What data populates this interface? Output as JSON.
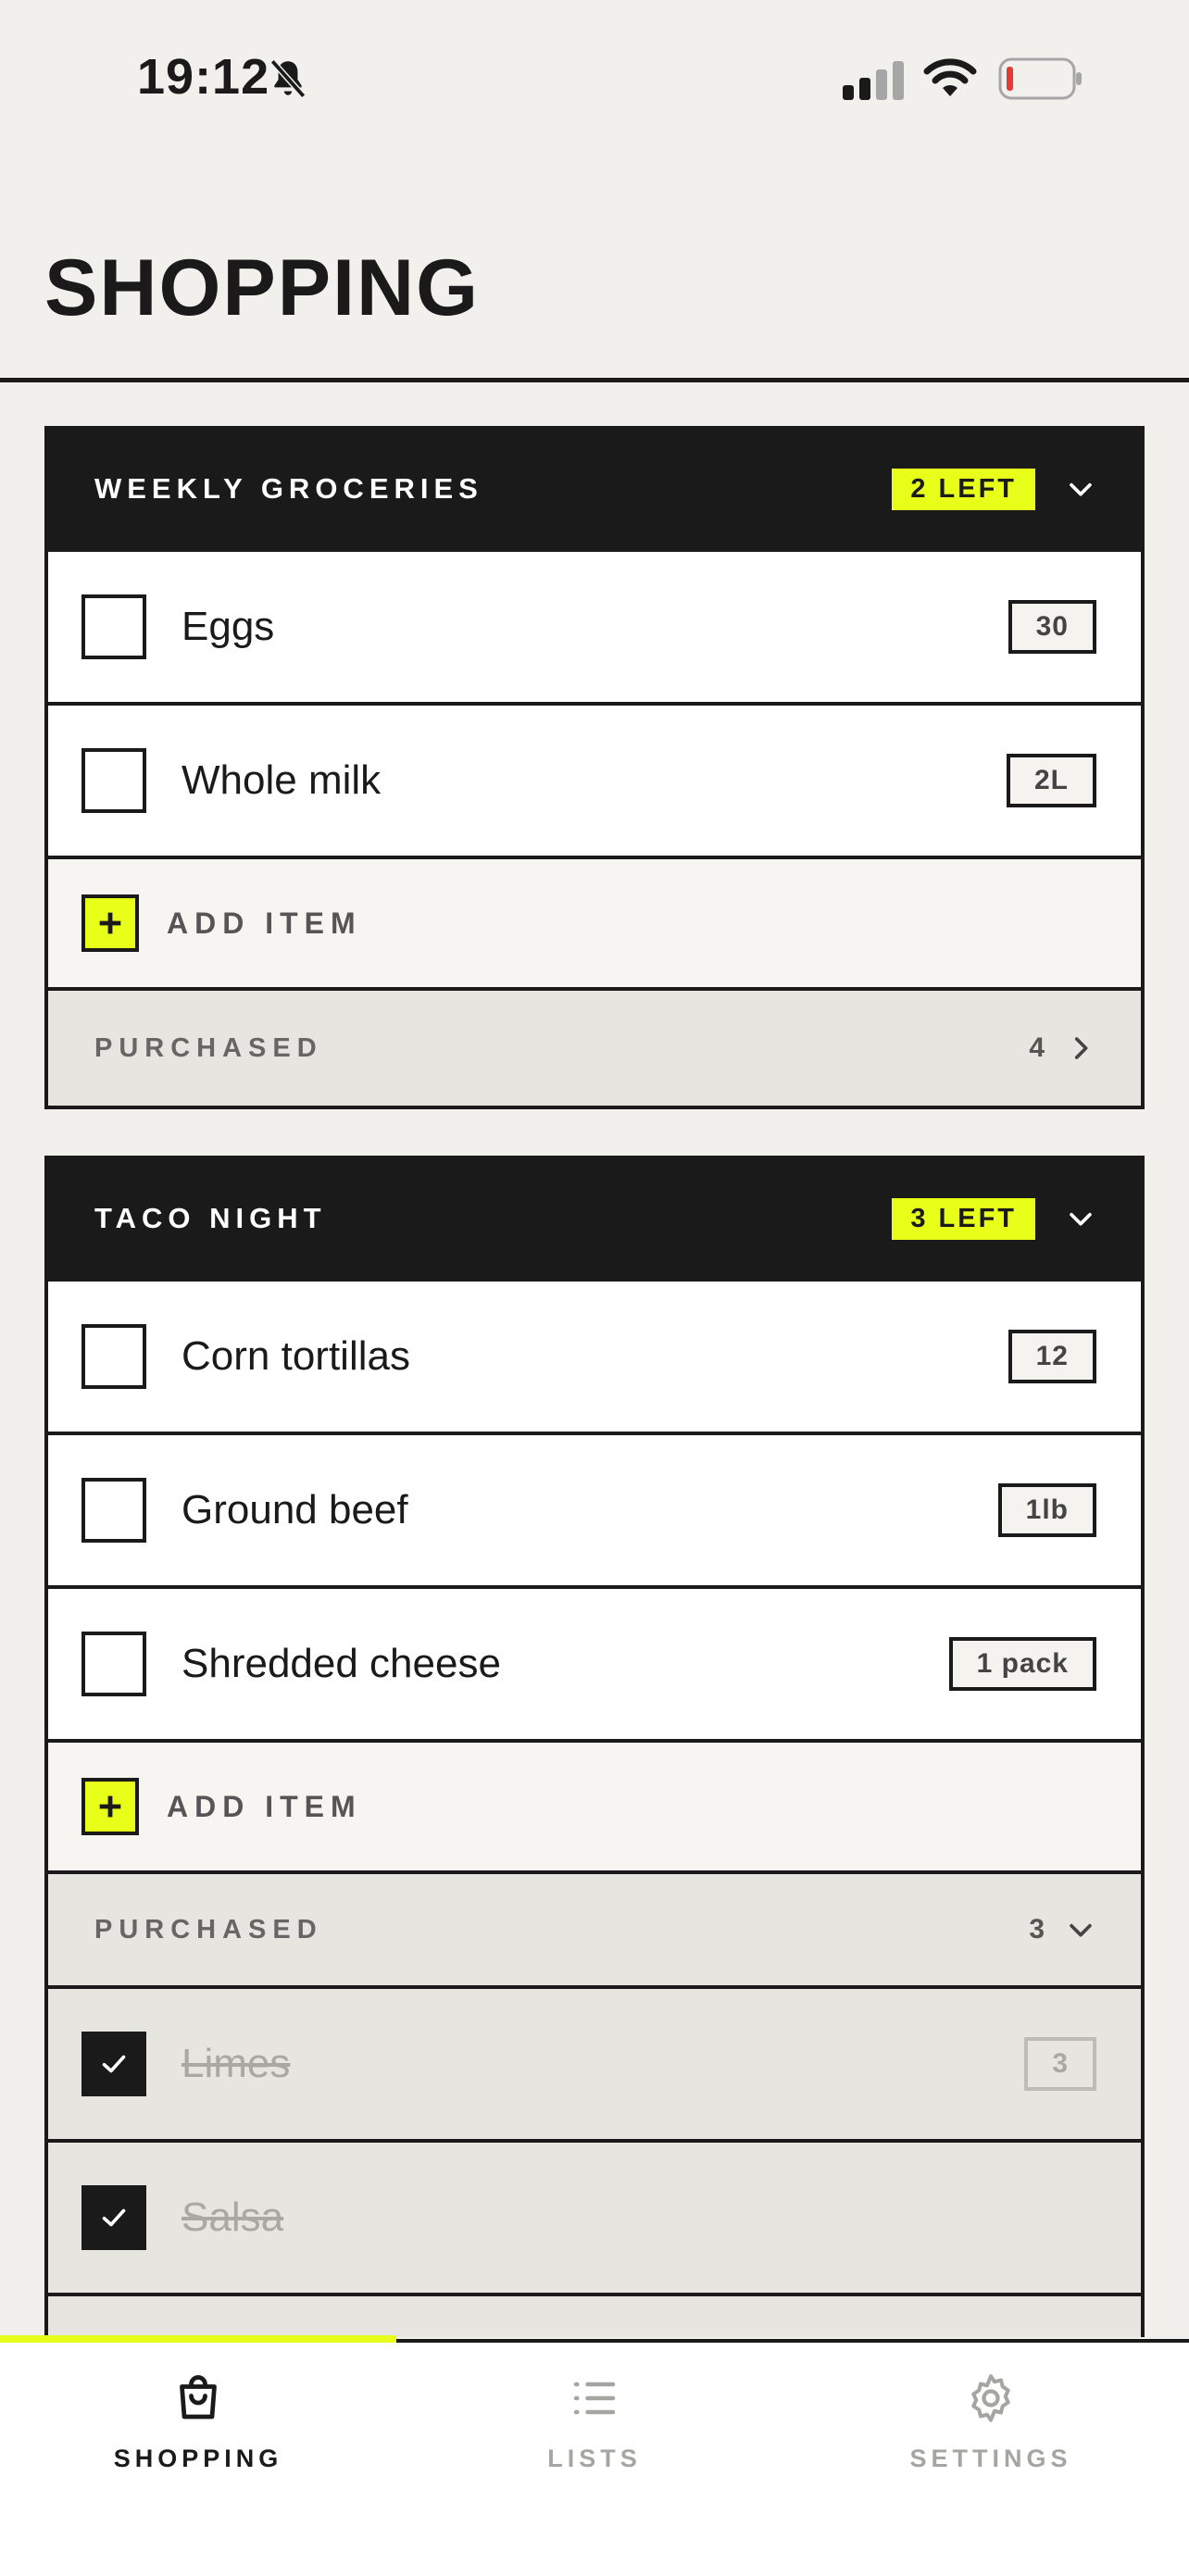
{
  "status_bar": {
    "time": "19:12",
    "icons": [
      "bell-slash-icon",
      "cellular-signal-icon",
      "wifi-icon",
      "battery-low-icon"
    ]
  },
  "page": {
    "title": "SHOPPING"
  },
  "colors": {
    "accent": "#e8ff1a",
    "ink": "#1a1a1a",
    "background": "#f1f0ec",
    "battery_low": "#e53935"
  },
  "lists": [
    {
      "title": "WEEKLY GROCERIES",
      "badge": "2 LEFT",
      "items": [
        {
          "name": "Eggs",
          "qty": "30"
        },
        {
          "name": "Whole milk",
          "qty": "2L"
        }
      ],
      "add_label": "ADD ITEM",
      "purchased_label": "PURCHASED",
      "purchased_count": "4"
    },
    {
      "title": "TACO NIGHT",
      "badge": "3 LEFT",
      "items": [
        {
          "name": "Corn tortillas",
          "qty": "12"
        },
        {
          "name": "Ground beef",
          "qty": "1lb"
        },
        {
          "name": "Shredded cheese",
          "qty": "1 pack"
        }
      ],
      "add_label": "ADD ITEM",
      "purchased_label": "PURCHASED",
      "purchased_count": "3",
      "purchased_items": [
        {
          "name": "Limes",
          "qty": "3"
        },
        {
          "name": "Salsa",
          "qty": ""
        }
      ]
    }
  ],
  "nav": [
    {
      "label": "SHOPPING",
      "icon": "shopping-bag-icon",
      "active": true
    },
    {
      "label": "LISTS",
      "icon": "list-icon",
      "active": false
    },
    {
      "label": "SETTINGS",
      "icon": "gear-icon",
      "active": false
    }
  ]
}
